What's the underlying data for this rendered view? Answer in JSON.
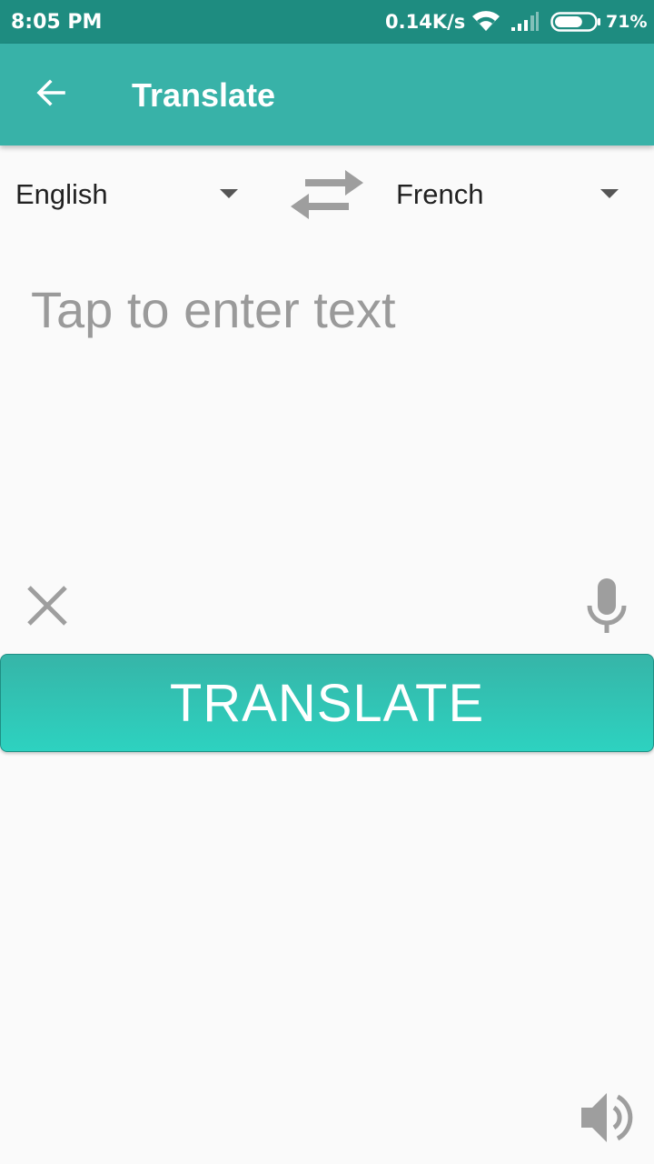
{
  "status_bar": {
    "time": "8:05 PM",
    "network_speed": "0.14K/s",
    "battery_percent": "71%",
    "battery_level": 0.71,
    "icons": [
      "wifi-icon",
      "signal-icon",
      "battery-icon"
    ]
  },
  "app_bar": {
    "title": "Translate",
    "back_icon": "arrow-back-icon"
  },
  "languages": {
    "source": "English",
    "target": "French",
    "swap_icon": "swap-arrows-icon"
  },
  "input": {
    "value": "",
    "placeholder": "Tap to enter text",
    "clear_icon": "close-icon",
    "mic_icon": "mic-icon"
  },
  "translate_button": {
    "label": "TRANSLATE"
  },
  "output": {
    "text": "",
    "speaker_icon": "speaker-icon"
  },
  "colors": {
    "status_bar": "#1e8c80",
    "app_bar": "#38b2a8",
    "button_top": "#36b5a8",
    "button_bottom": "#2dd2c0",
    "background": "#fafafa",
    "icon_gray": "#9e9e9e"
  }
}
